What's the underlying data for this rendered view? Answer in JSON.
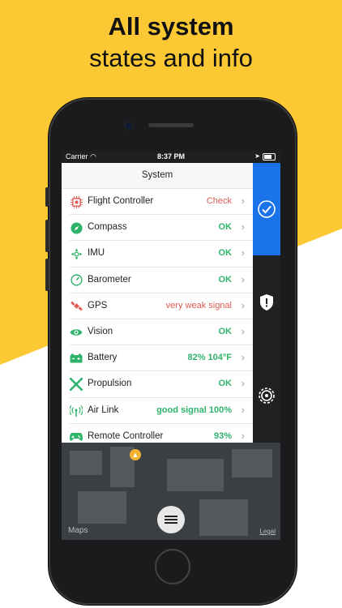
{
  "colors": {
    "background_yellow": "#fcc934",
    "accent_blue": "#1a73e8",
    "ok_green": "#2fb36b",
    "warn_red": "#e05a52",
    "icon_green": "#2fb36b",
    "icon_red": "#e05a52"
  },
  "headline": {
    "line1": "All system",
    "line2": "states and info"
  },
  "status_bar": {
    "carrier": "Carrier",
    "time": "8:37 PM"
  },
  "panel": {
    "title": "System",
    "rows": [
      {
        "label": "Flight Controller",
        "value": "Check",
        "status": "warn",
        "icon": "chip-icon"
      },
      {
        "label": "Compass",
        "value": "OK",
        "status": "ok",
        "icon": "compass-icon"
      },
      {
        "label": "IMU",
        "value": "OK",
        "status": "ok",
        "icon": "imu-icon"
      },
      {
        "label": "Barometer",
        "value": "OK",
        "status": "ok",
        "icon": "barometer-icon"
      },
      {
        "label": "GPS",
        "value": "very weak signal",
        "status": "warn",
        "icon": "satellite-icon"
      },
      {
        "label": "Vision",
        "value": "OK",
        "status": "ok",
        "icon": "eye-icon"
      },
      {
        "label": "Battery",
        "value": "82% 104°F",
        "status": "ok",
        "icon": "battery-icon"
      },
      {
        "label": "Propulsion",
        "value": "OK",
        "status": "ok",
        "icon": "propeller-icon"
      },
      {
        "label": "Air Link",
        "value": "good signal 100%",
        "status": "ok",
        "icon": "antenna-icon"
      },
      {
        "label": "Remote Controller",
        "value": "93%",
        "status": "ok",
        "icon": "gamepad-icon"
      }
    ]
  },
  "rail": {
    "items": [
      "checkmark-icon",
      "shield-icon",
      "gear-icon"
    ]
  },
  "map": {
    "attribution": "Maps",
    "legal": "Legal"
  }
}
